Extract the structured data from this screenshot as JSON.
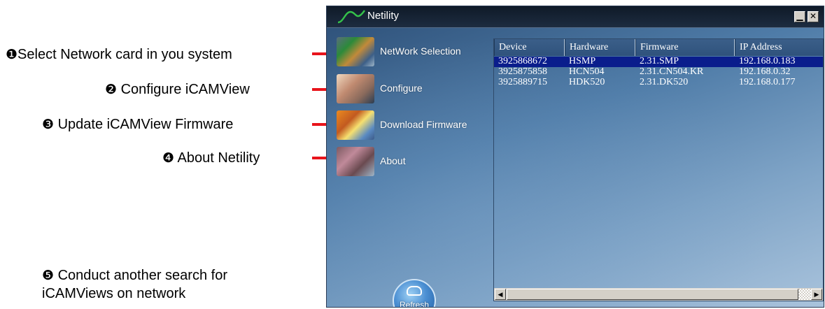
{
  "annotations": [
    {
      "num": "❶",
      "text": "Select Network card in you system"
    },
    {
      "num": "❷",
      "text": "Configure iCAMView"
    },
    {
      "num": "❸",
      "text": "Update iCAMView Firmware"
    },
    {
      "num": "❹",
      "text": "About Netility"
    },
    {
      "num": "❺",
      "text_line1": "Conduct another search for",
      "text_line2": "iCAMViews on network"
    }
  ],
  "window": {
    "title": "Netility",
    "min_glyph": "▁",
    "close_glyph": "✕"
  },
  "sidebar": {
    "items": [
      {
        "label": "NetWork Selection",
        "icon": "network-cards-icon"
      },
      {
        "label": "Configure",
        "icon": "configure-hand-icon"
      },
      {
        "label": "Download Firmware",
        "icon": "download-firmware-icon"
      },
      {
        "label": "About",
        "icon": "about-icon"
      }
    ],
    "refresh_label": "Refresh"
  },
  "device_list": {
    "columns": [
      "Device",
      "Hardware",
      "Firmware",
      "IP Address"
    ],
    "rows": [
      [
        "3925868672",
        "HSMP",
        "2.31.SMP",
        "192.168.0.183"
      ],
      [
        "3925875858",
        "HCN504",
        "2.31.CN504.KR",
        "192.168.0.32"
      ],
      [
        "3925889715",
        "HDK520",
        "2.31.DK520",
        "192.168.0.177"
      ]
    ],
    "selected_row": 0,
    "scroll_left_glyph": "◀",
    "scroll_right_glyph": "▶"
  },
  "colors": {
    "annotation_arrow": "#e8141b",
    "selection": "#0a1d8c",
    "titlebar": "#0f1a28"
  }
}
